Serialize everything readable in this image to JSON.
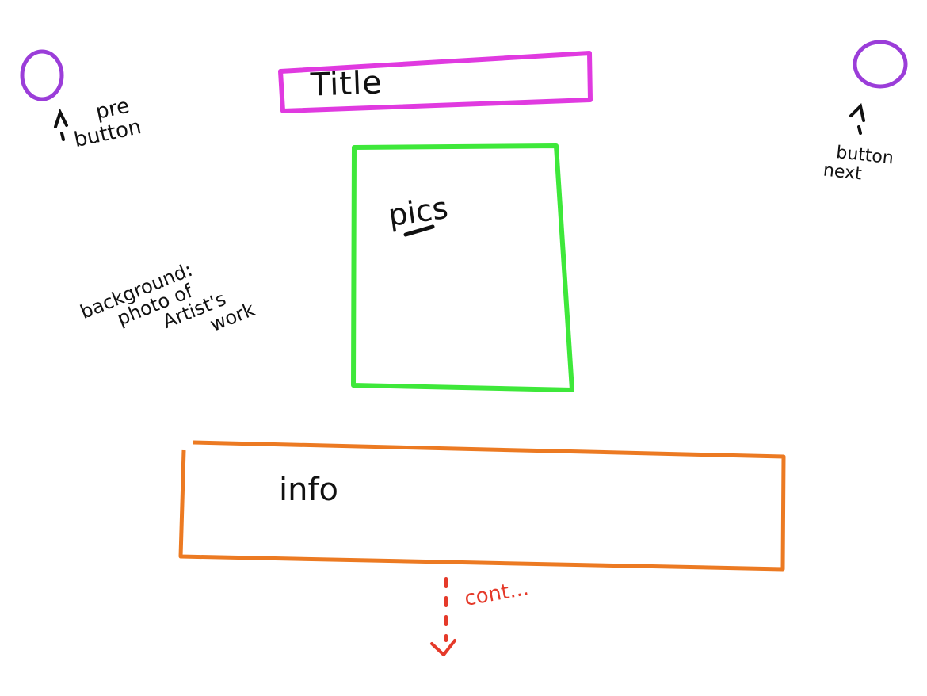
{
  "colors": {
    "button_circle": "#9b3dd9",
    "title_box": "#e03ae0",
    "pics_box": "#3ee83a",
    "info_box": "#ec7a22",
    "cont_arrow": "#e53a2a",
    "ink": "#111111"
  },
  "title_box": {
    "label": "Title"
  },
  "pics_box": {
    "label": "pics"
  },
  "info_box": {
    "label": "info"
  },
  "prev_button": {
    "caption_line1": "pre",
    "caption_line2": "button"
  },
  "next_button": {
    "caption_line1": "button",
    "caption_line2": "next"
  },
  "background_note": {
    "line1": "background:",
    "line2": "photo of",
    "line3": "Artist's",
    "line4": "work"
  },
  "continuation": {
    "label": "cont..."
  }
}
